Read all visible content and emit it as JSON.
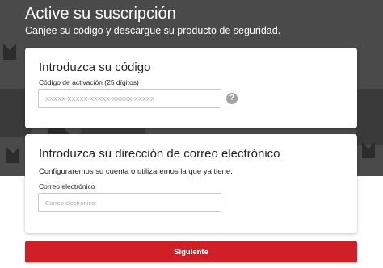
{
  "header": {
    "title": "Active su suscripción",
    "subtitle": "Canjee su código y descargue su producto de seguridad."
  },
  "code_card": {
    "title": "Introduzca su código",
    "field_label": "Código de activación (25 dígitos)",
    "placeholder": "XXXXX-XXXXX-XXXXX-XXXXX-XXXXX",
    "value": "",
    "help_icon": "question-circle-icon"
  },
  "email_card": {
    "title": "Introduzca su dirección de correo electrónico",
    "description": "Configuraremos su cuenta o utilizaremos la que ya tiene.",
    "field_label": "Correo electrónico",
    "placeholder": "Correo electrónico",
    "value": ""
  },
  "submit": {
    "label": "Siguiente"
  },
  "colors": {
    "hero_bg": "#4a4a4a",
    "accent": "#d01f27",
    "card_bg": "#ffffff"
  }
}
